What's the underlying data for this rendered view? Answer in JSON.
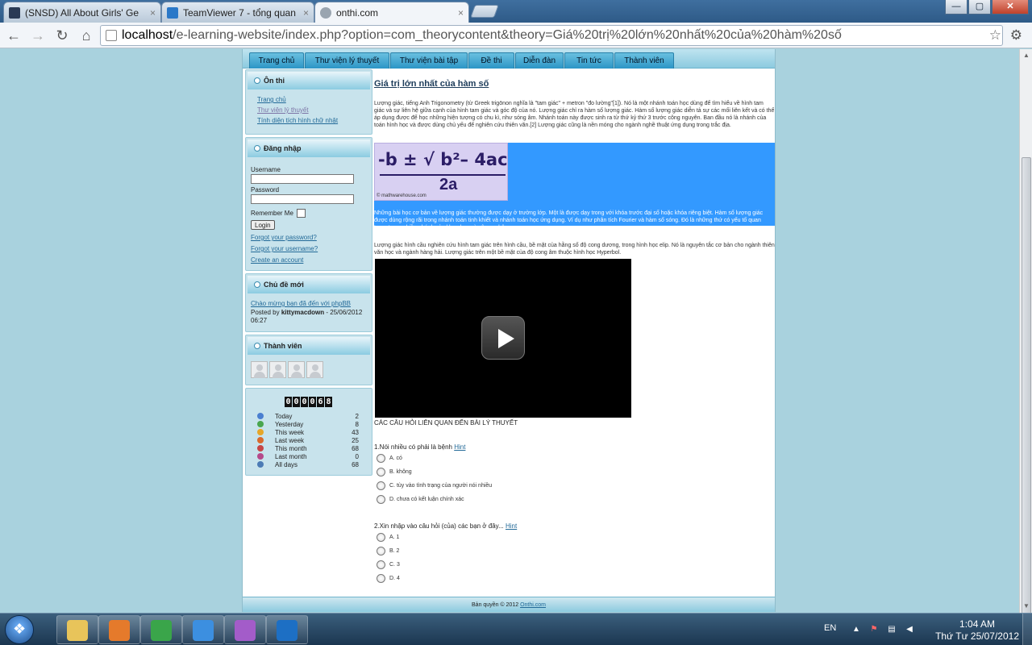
{
  "browser": {
    "tabs": [
      {
        "title": "(SNSD) All About Girls' Ge",
        "close": "×",
        "icon_color": "#2a3a55"
      },
      {
        "title": "TeamViewer 7 - tổng quan",
        "close": "×",
        "icon_color": "#2a78c8"
      },
      {
        "title": "onthi.com",
        "close": "×",
        "icon_color": "#9aa5b0"
      }
    ],
    "window_buttons": {
      "minimize": "—",
      "maximize": "▢",
      "close": "✕"
    },
    "url_host": "localhost",
    "url_rest": "/e-learning-website/index.php?option=com_theorycontent&theory=Giá%20trị%20lớn%20nhất%20của%20hàm%20số"
  },
  "site": {
    "menu": [
      "Trang chủ",
      "Thư viện lý thuyết",
      "Thư viện bài tập",
      "Đề thi",
      "Diễn đàn",
      "Tin tức",
      "Thành viên"
    ],
    "on_thi": {
      "title": "Ôn thi",
      "links": [
        "Trang chủ",
        "Thư viện lý thuyết",
        "Tính diện tích hình chữ nhật"
      ]
    },
    "login": {
      "title": "Đăng nhập",
      "username_label": "Username",
      "password_label": "Password",
      "remember_label": "Remember Me",
      "login_button": "Login",
      "forgot_password": "Forgot your password?",
      "forgot_username": "Forgot your username?",
      "create_account": "Create an account"
    },
    "new_topics": {
      "title": "Chủ đề mới",
      "topic_link": "Chào mừng bạn đã đến với phpBB",
      "posted_by_prefix": "Posted by",
      "author": "kittymacdown",
      "posted_date": "- 25/06/2012 06:27"
    },
    "members": {
      "title": "Thành viên"
    },
    "visitor_counter": {
      "digits": [
        "0",
        "0",
        "0",
        "0",
        "6",
        "8"
      ],
      "rows": [
        {
          "label": "Today",
          "value": "2",
          "color": "#4a7fd0"
        },
        {
          "label": "Yesterday",
          "value": "8",
          "color": "#49a64f"
        },
        {
          "label": "This week",
          "value": "43",
          "color": "#e6a628"
        },
        {
          "label": "Last week",
          "value": "25",
          "color": "#d96a2c"
        },
        {
          "label": "This month",
          "value": "68",
          "color": "#c64646"
        },
        {
          "label": "Last month",
          "value": "0",
          "color": "#b54a8b"
        },
        {
          "label": "All days",
          "value": "68",
          "color": "#4c7bb5"
        }
      ]
    },
    "article": {
      "title": "Giá trị lớn nhất của hàm số",
      "intro": "Lượng giác, tiếng Anh Trigonometry (từ Greek trigōnon nghĩa là \"tam giác\" + metron \"đo lường\"[1]). Nó là một nhánh toán học dùng để tìm hiểu về hình tam giác và sự liên hệ giữa cạnh của hình tam giác và góc độ của nó. Lượng giác chỉ ra hàm số lượng giác. Hàm số lượng giác diễn tả sự các mối liên kết và có thể áp dụng được để học những hiện tượng có chu kì, như sóng âm. Nhánh toán này được sinh ra từ thứ kỷ thứ 3 trước công nguyên. Ban đầu nó là nhánh của toán hình học và được dùng chủ yếu để nghiên cứu thiên văn.[2] Lượng giác cũng là nền móng cho ngành nghề thuật ứng dụng trong trắc địa.",
      "formula_numerator": "-b ± √ b²– 4ac",
      "formula_denominator": "2a",
      "formula_credit": "© mathwarehouse.com",
      "highlighted": "Những bài học cơ bản về lượng giác thường được dạy ở trường lớp. Một là được dạy trong với khóa trước đại số hoặc khóa riêng biệt. Hàm số lượng giác được dùng rộng rãi trong nhánh toán tinh khiết và nhánh toán học ứng dụng. Ví dụ như phân tích Fourier và hàm số sóng. Đó là những thứ có yếu tố quan trọng trong nhiều nhánh của khoa học và công nghệ.",
      "para2": "Lượng giác hình cầu nghiên cứu hình tam giác trên hình cầu, bề mặt của hằng số độ cong dương, trong hình học elip. Nó là nguyên tắc cơ bản cho ngành thiên văn học và ngành hàng hải. Lượng giác trên một bề mặt của độ cong âm thuộc hình học Hyperbol.",
      "related_heading": "CÁC CÂU HỎI LIÊN QUAN ĐẾN BÀI LÝ THUYẾT"
    },
    "questions": [
      {
        "text": "1.Nói nhiều có phải là bệnh",
        "hint": "Hint",
        "answers": [
          "A. có",
          "B. không",
          "C. tùy vào tình trạng của người nói nhiều",
          "D. chưa có kết luận chính xác"
        ]
      },
      {
        "text": "2.Xin nhập vào câu hỏi (của) các bạn ở đây...",
        "hint": "Hint",
        "answers": [
          "A. 1",
          "B. 2",
          "C. 3",
          "D. 4"
        ]
      }
    ],
    "footer": {
      "text": "Bản quyền © 2012",
      "link": "Onthi.com"
    }
  },
  "taskbar": {
    "apps": [
      {
        "name": "explorer",
        "color": "#e8c45a"
      },
      {
        "name": "media-player",
        "color": "#e57a2b"
      },
      {
        "name": "chrome",
        "color": "#3aa54a"
      },
      {
        "name": "internet-explorer",
        "color": "#3c8fe0"
      },
      {
        "name": "app-purple",
        "color": "#a35cc9"
      },
      {
        "name": "teamviewer",
        "color": "#1d6fc4"
      }
    ],
    "language": "EN",
    "time": "1:04 AM",
    "date": "Thứ Tư 25/07/2012"
  }
}
